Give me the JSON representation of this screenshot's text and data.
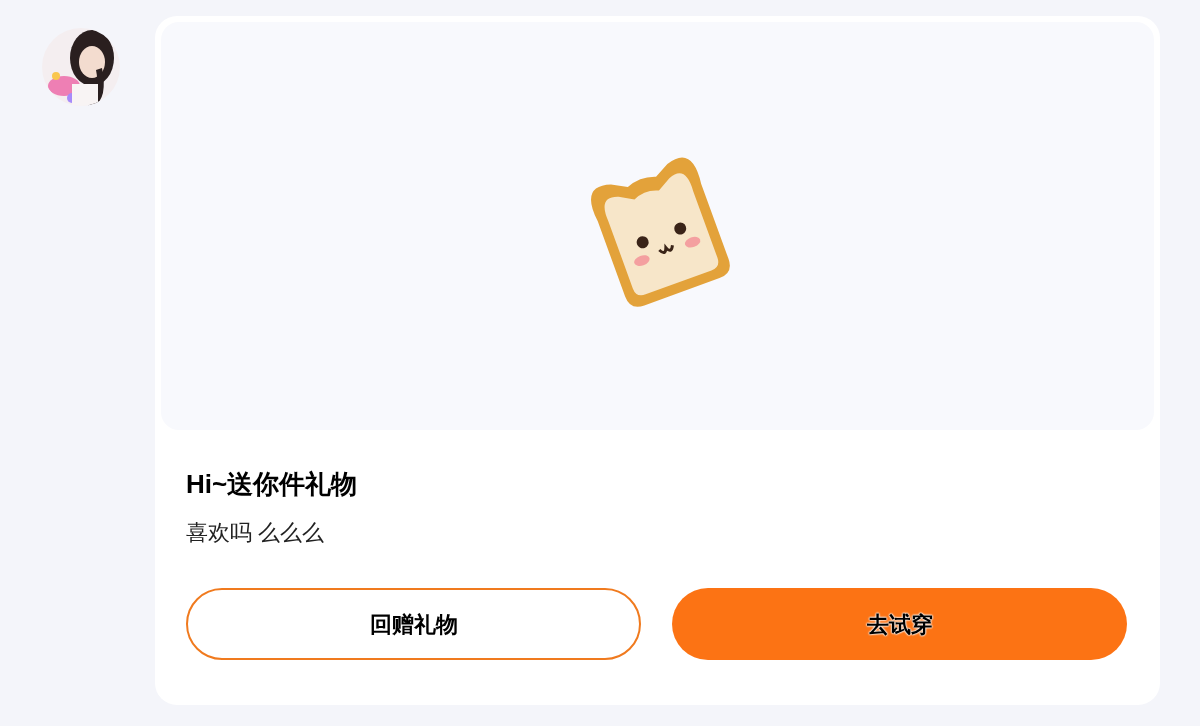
{
  "gift_card": {
    "title": "Hi~送你件礼物",
    "message": "喜欢吗 么么么",
    "buttons": [
      {
        "label": "回赠礼物",
        "kind": "outline"
      },
      {
        "label": "去试穿",
        "kind": "filled"
      }
    ]
  }
}
